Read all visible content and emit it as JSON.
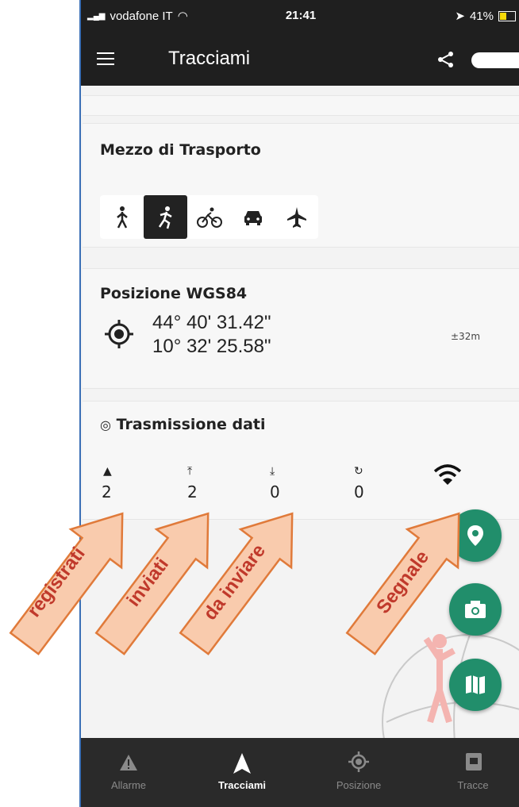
{
  "status_bar": {
    "carrier": "vodafone IT",
    "time": "21:41",
    "battery": "41%"
  },
  "app_bar": {
    "title": "Tracciami"
  },
  "transport": {
    "title": "Mezzo di Trasporto",
    "modes": [
      "walk",
      "run",
      "bike",
      "car",
      "plane"
    ],
    "selected": "run"
  },
  "position": {
    "title": "Posizione WGS84",
    "lat": "44° 40' 31.42\"",
    "lon": "10° 32' 25.58\"",
    "accuracy": "±32m"
  },
  "transmission": {
    "title": "Trasmissione dati",
    "stats": [
      {
        "icon": "registered-icon",
        "value": "2"
      },
      {
        "icon": "sent-icon",
        "value": "2"
      },
      {
        "icon": "to-send-icon",
        "value": "0"
      },
      {
        "icon": "retry-icon",
        "value": "0"
      }
    ]
  },
  "annotations": {
    "registrati": "registrati",
    "inviati": "inviati",
    "da_inviare": "da inviare",
    "segnale": "Segnale"
  },
  "bottom_nav": [
    {
      "label": "Allarme",
      "icon": "alarm-icon"
    },
    {
      "label": "Tracciami",
      "icon": "track-icon",
      "active": true
    },
    {
      "label": "Posizione",
      "icon": "position-icon"
    },
    {
      "label": "Tracce",
      "icon": "traces-icon"
    }
  ],
  "colors": {
    "fab": "#218e6b",
    "arrow_fill": "#f9cbad",
    "arrow_stroke": "#e07a3a",
    "annotation_text": "#c0392b"
  }
}
